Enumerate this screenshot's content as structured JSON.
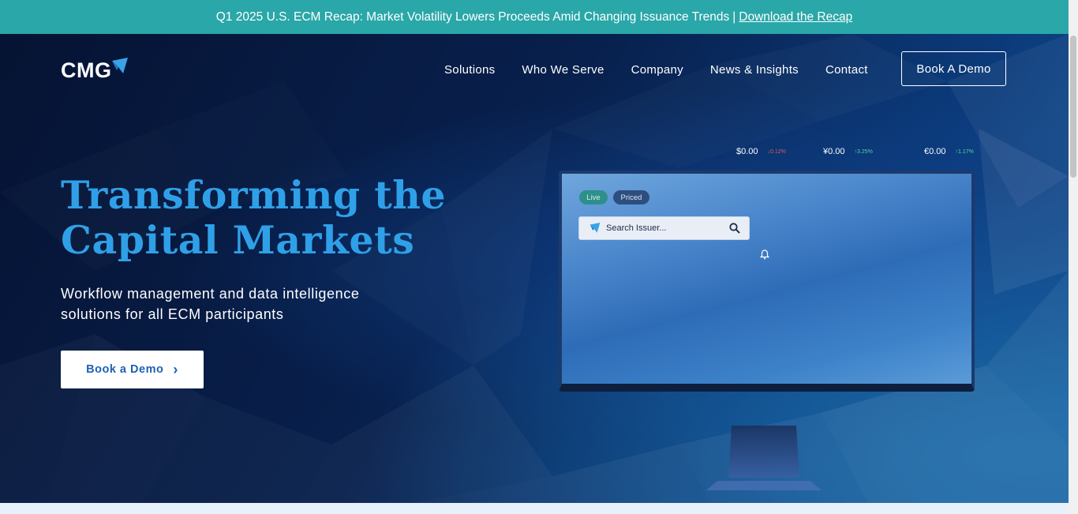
{
  "announcement": {
    "text": "Q1 2025 U.S. ECM Recap: Market Volatility Lowers Proceeds Amid Changing Issuance Trends",
    "separator": "|",
    "link_label": "Download the Recap"
  },
  "header": {
    "logo_text": "CMG",
    "nav": [
      {
        "label": "Solutions"
      },
      {
        "label": "Who We Serve"
      },
      {
        "label": "Company"
      },
      {
        "label": "News & Insights"
      },
      {
        "label": "Contact"
      }
    ],
    "demo_button": "Book A Demo"
  },
  "hero": {
    "headline_line1": "Transforming the",
    "headline_line2": "Capital Markets",
    "subtitle": "Workflow management and data intelligence solutions for all ECM participants",
    "cta_label": "Book a Demo"
  },
  "tickers": [
    {
      "price": "$0.00",
      "change": "↓0.12%",
      "direction": "down"
    },
    {
      "price": "¥0.00",
      "change": "↑3.25%",
      "direction": "up"
    },
    {
      "price": "€0.00",
      "change": "↑1.17%",
      "direction": "up"
    }
  ],
  "monitor": {
    "pill_live": "Live",
    "pill_priced": "Priced",
    "search_placeholder": "Search Issuer..."
  },
  "colors": {
    "announcement_bg": "#2aa7a8",
    "headline": "#2fa0e8",
    "cta_text": "#1b63b3",
    "hero_dark": "#07163a"
  },
  "icons": [
    "cmg-logo-flag-icon",
    "search-icon",
    "bell-icon",
    "chevron-right-icon"
  ]
}
